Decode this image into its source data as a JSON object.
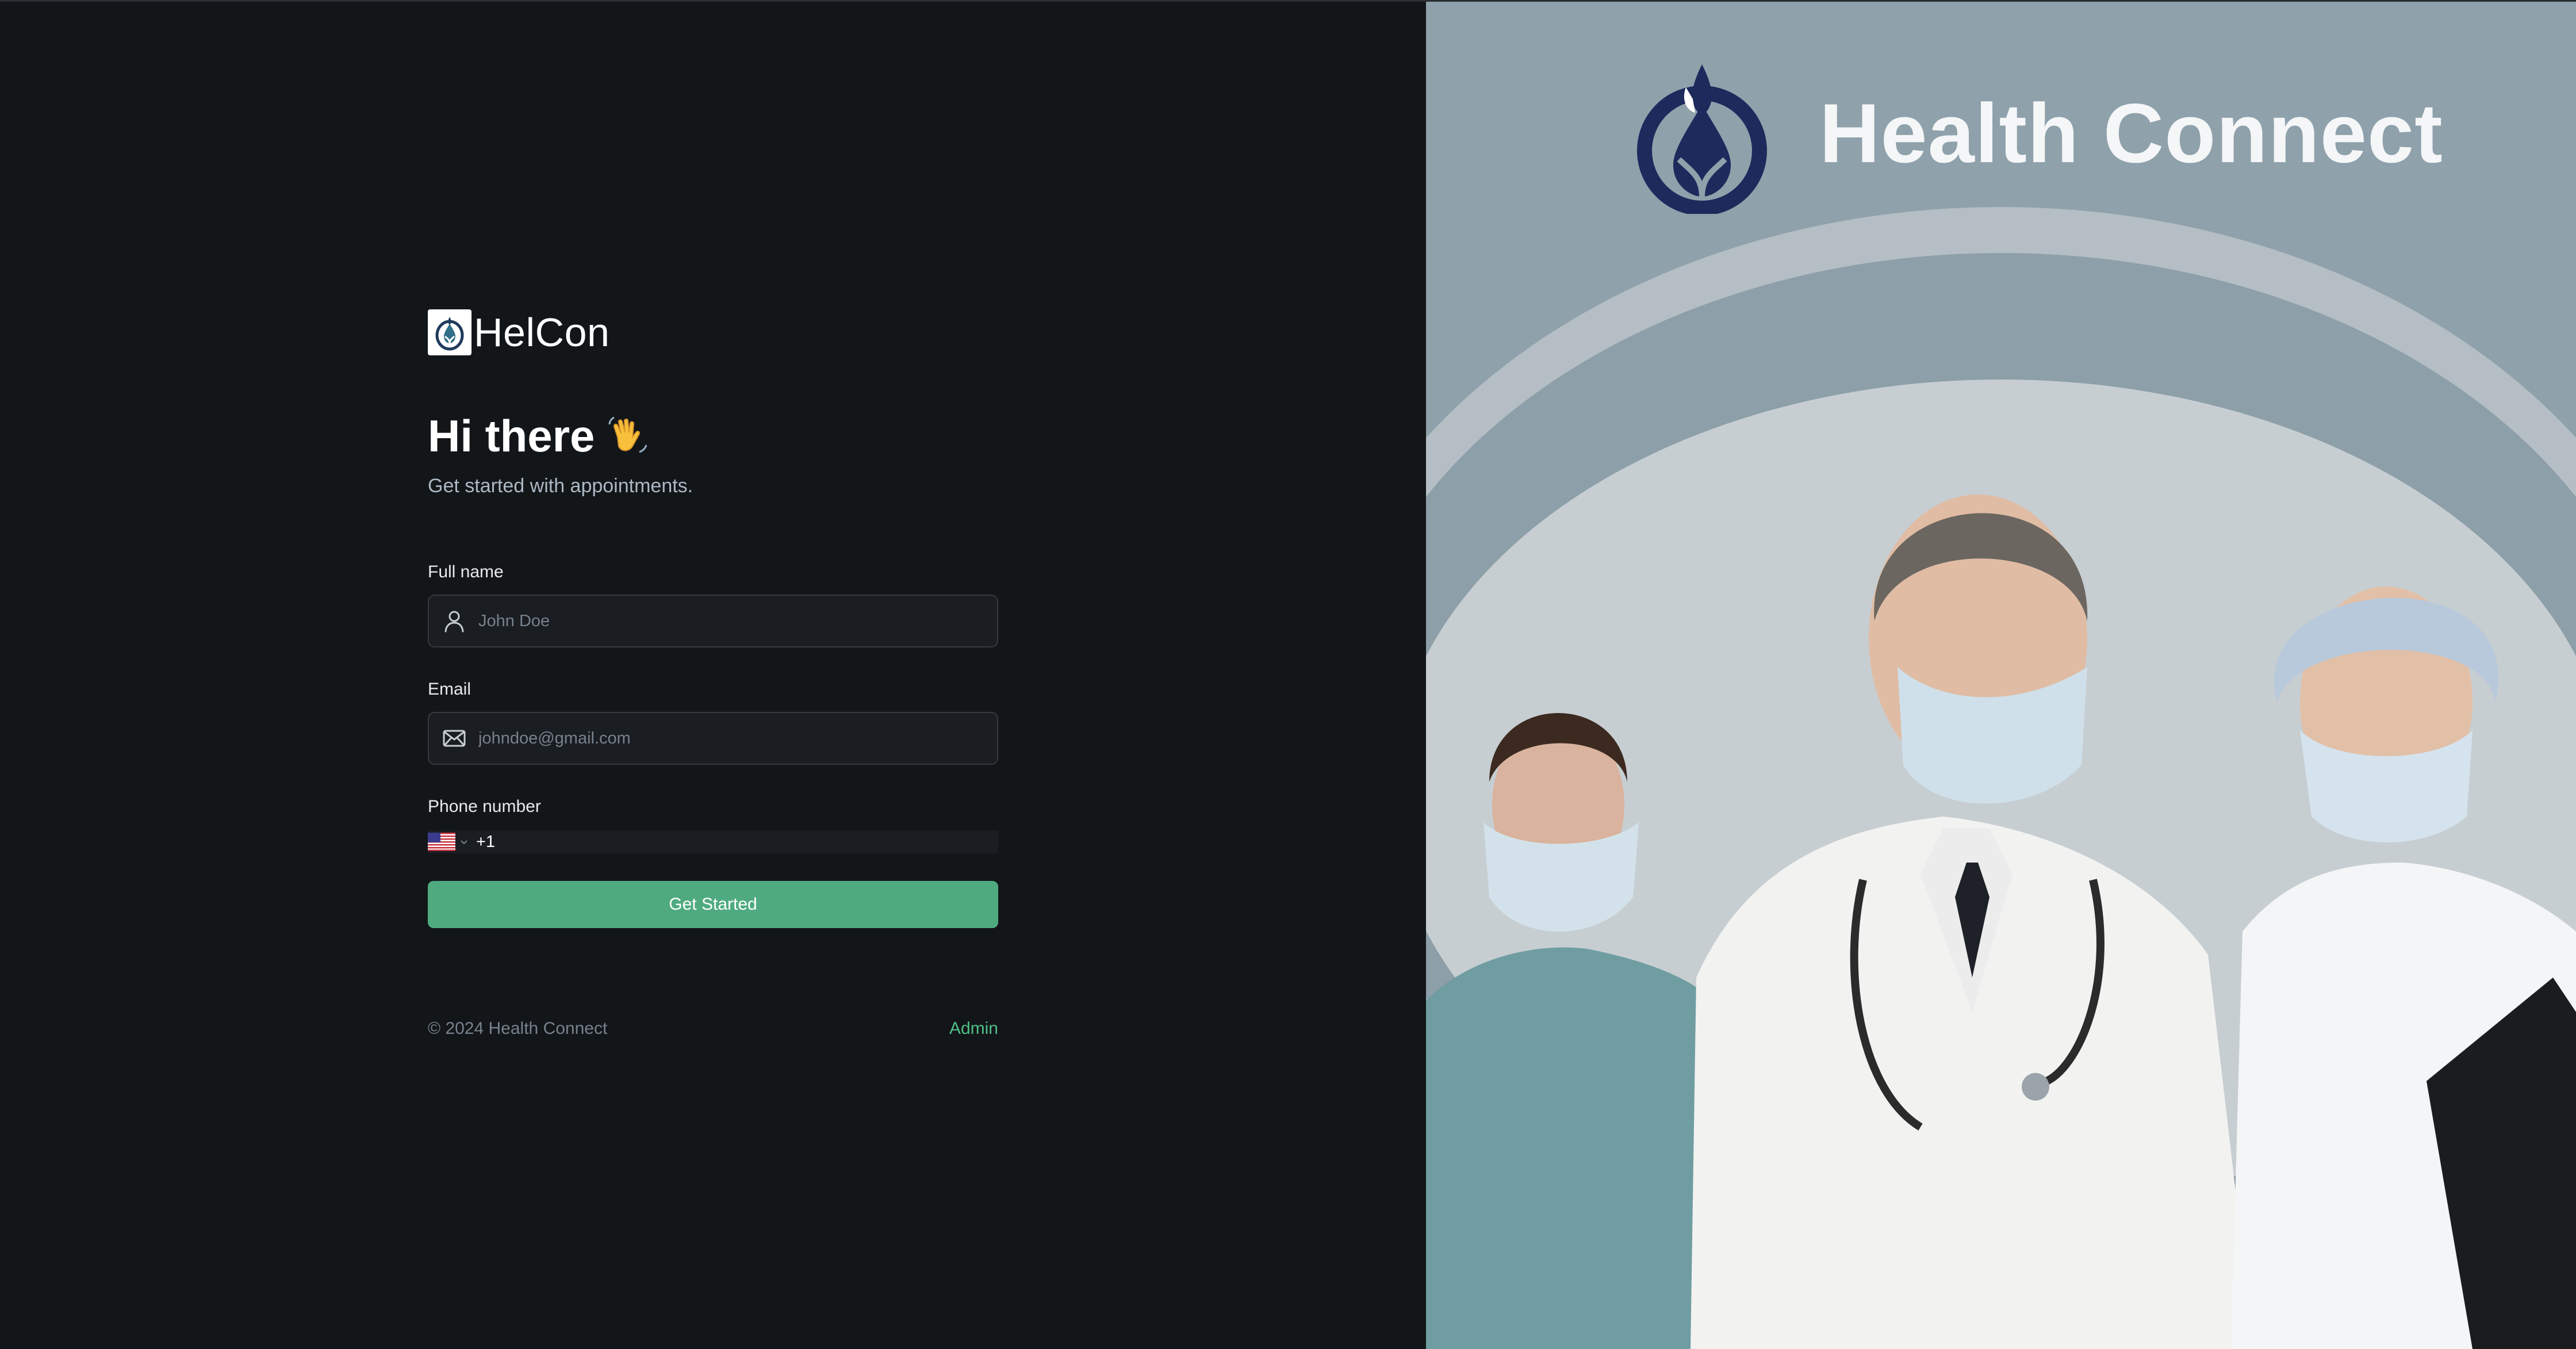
{
  "app": {
    "logo_text": "HelCon"
  },
  "hero": {
    "greeting": "Hi there",
    "subtitle": "Get started with appointments."
  },
  "form": {
    "full_name": {
      "label": "Full name",
      "placeholder": "John Doe",
      "icon": "user-icon"
    },
    "email": {
      "label": "Email",
      "placeholder": "johndoe@gmail.com",
      "icon": "mail-icon"
    },
    "phone": {
      "label": "Phone number",
      "country_flag": "us-flag-icon",
      "dial_code": "+1"
    },
    "submit_label": "Get Started"
  },
  "footer": {
    "copyright": "© 2024 Health Connect",
    "admin_link": "Admin"
  },
  "banner": {
    "brand_name": "Health Connect"
  },
  "colors": {
    "background": "#131619",
    "input_bg": "#1a1d21",
    "input_border": "#363a3d",
    "accent_green": "#4fab7f",
    "admin_link": "#4fbf86",
    "muted_text": "#76828d",
    "banner_bg": "#8fa1aa"
  }
}
